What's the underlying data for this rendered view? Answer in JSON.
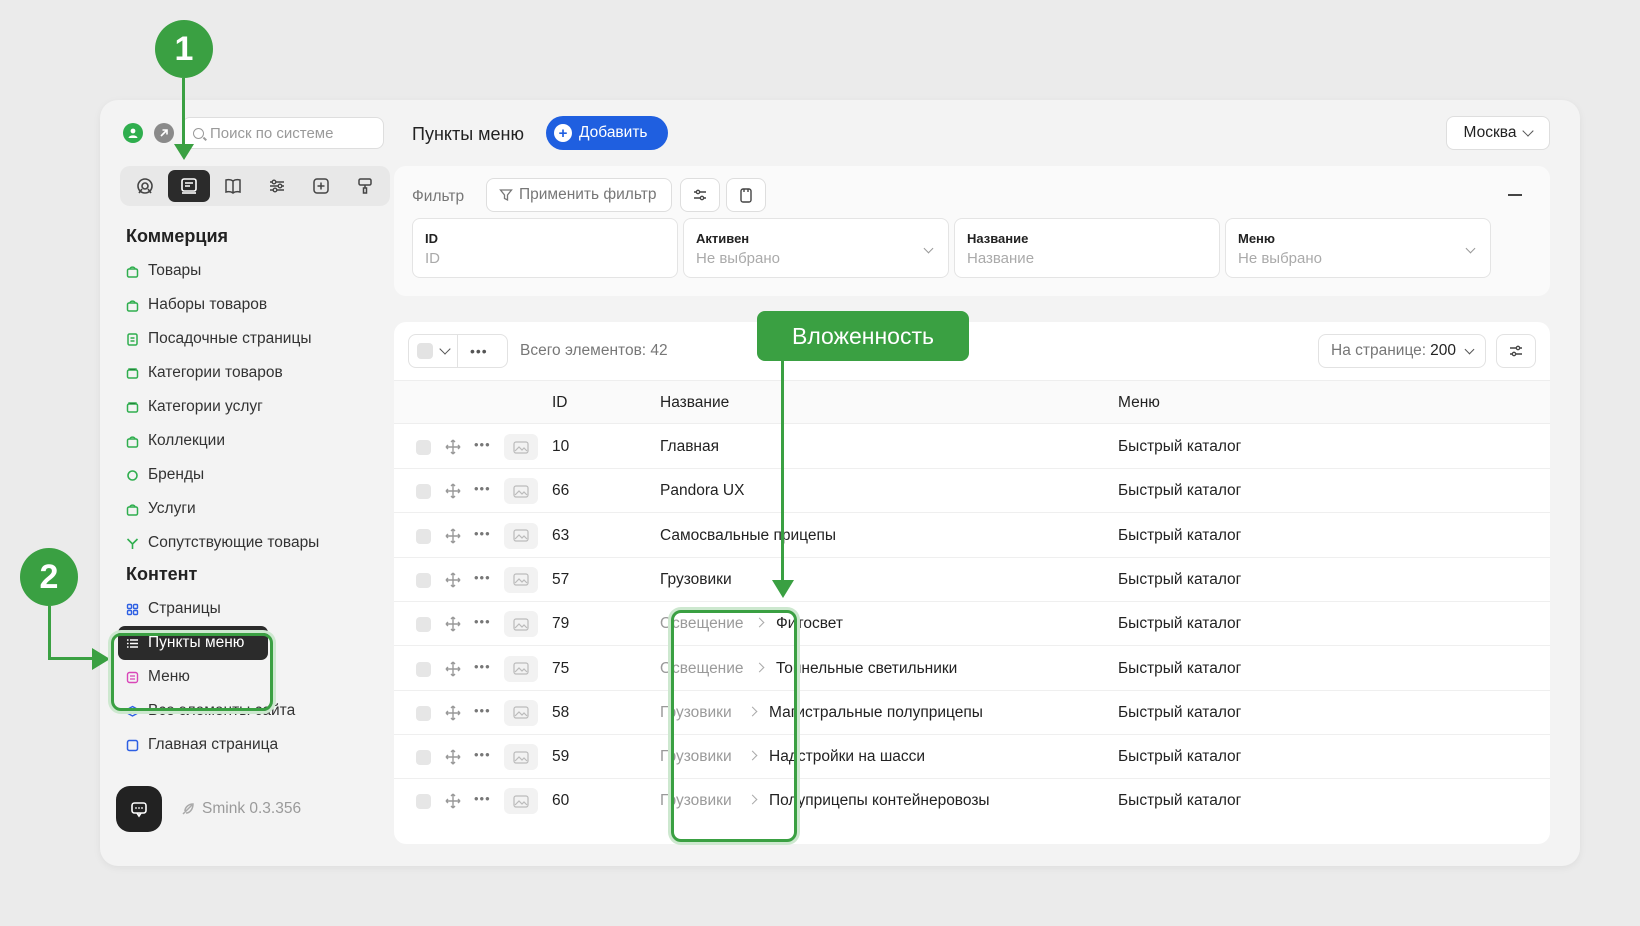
{
  "sidebar": {
    "search_placeholder": "Поиск по системе",
    "sections": [
      {
        "title": "Коммерция",
        "items": [
          {
            "label": "Товары",
            "icon": "bag-icon",
            "color": "#2fae4e"
          },
          {
            "label": "Наборы товаров",
            "icon": "bag-icon",
            "color": "#2fae4e"
          },
          {
            "label": "Посадочные страницы",
            "icon": "page-icon",
            "color": "#2fae4e"
          },
          {
            "label": "Категории товаров",
            "icon": "folder-icon",
            "color": "#2fae4e"
          },
          {
            "label": "Категории услуг",
            "icon": "folder-icon",
            "color": "#2fae4e"
          },
          {
            "label": "Коллекции",
            "icon": "bag-icon",
            "color": "#2fae4e"
          },
          {
            "label": "Бренды",
            "icon": "badge-icon",
            "color": "#2fae4e"
          },
          {
            "label": "Услуги",
            "icon": "bag-icon",
            "color": "#2fae4e"
          },
          {
            "label": "Сопутствующие товары",
            "icon": "merge-icon",
            "color": "#2fae4e"
          }
        ]
      },
      {
        "title": "Контент",
        "items": [
          {
            "label": "Страницы",
            "icon": "grid-icon",
            "color": "#2d5fe3"
          },
          {
            "label": "Пункты меню",
            "icon": "list-icon",
            "color": "#ffffff",
            "active": true
          },
          {
            "label": "Меню",
            "icon": "menu-icon",
            "color": "#d946b8"
          },
          {
            "label": "Все элементы сайта",
            "icon": "layers-icon",
            "color": "#2d5fe3"
          },
          {
            "label": "Главная страница",
            "icon": "square-icon",
            "color": "#2d5fe3"
          }
        ]
      }
    ],
    "version": "Smink 0.3.356"
  },
  "header": {
    "title": "Пункты меню",
    "add_label": "Добавить",
    "city": "Москва"
  },
  "filter": {
    "label": "Фильтр",
    "apply_label": "Применить фильтр",
    "fields": [
      {
        "label": "ID",
        "placeholder": "ID",
        "dropdown": false
      },
      {
        "label": "Активен",
        "placeholder": "Не выбрано",
        "dropdown": true
      },
      {
        "label": "Название",
        "placeholder": "Название",
        "dropdown": false
      },
      {
        "label": "Меню",
        "placeholder": "Не выбрано",
        "dropdown": true
      }
    ]
  },
  "table": {
    "total": "Всего элементов: 42",
    "per_page_label": "На странице:",
    "per_page_value": "200",
    "columns": [
      "ID",
      "Название",
      "Меню"
    ],
    "rows": [
      {
        "id": "10",
        "parent": "",
        "name": "Главная",
        "menu": "Быстрый каталог"
      },
      {
        "id": "66",
        "parent": "",
        "name": "Pandora UX",
        "menu": "Быстрый каталог"
      },
      {
        "id": "63",
        "parent": "",
        "name": "Самосвальные прицепы",
        "menu": "Быстрый каталог"
      },
      {
        "id": "57",
        "parent": "",
        "name": "Грузовики",
        "menu": "Быстрый каталог"
      },
      {
        "id": "79",
        "parent": "Освещение",
        "name": "Фитосвет",
        "menu": "Быстрый каталог"
      },
      {
        "id": "75",
        "parent": "Освещение",
        "name": "Тоннельные светильники",
        "menu": "Быстрый каталог"
      },
      {
        "id": "58",
        "parent": "Грузовики",
        "name": "Магистральные полуприцепы",
        "menu": "Быстрый каталог"
      },
      {
        "id": "59",
        "parent": "Грузовики",
        "name": "Надстройки на шасси",
        "menu": "Быстрый каталог"
      },
      {
        "id": "60",
        "parent": "Грузовики",
        "name": "Полуприцепы контейнеровозы",
        "menu": "Быстрый каталог"
      }
    ]
  },
  "annotations": {
    "badge1": "1",
    "badge2": "2",
    "nesting_label": "Вложенность",
    "color": "#3aa042"
  }
}
